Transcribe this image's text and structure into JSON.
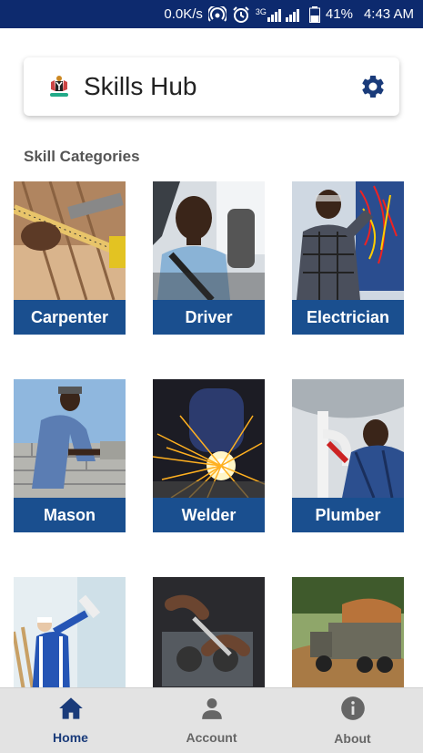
{
  "status_bar": {
    "speed": "0.0K/s",
    "network": "3G",
    "battery": "41%",
    "time": "4:43 AM"
  },
  "header": {
    "title": "Skills Hub",
    "logo_icon": "coat-of-arms-icon",
    "settings_icon": "gear-icon"
  },
  "section_title": "Skill Categories",
  "categories": [
    {
      "label": "Carpenter"
    },
    {
      "label": "Driver"
    },
    {
      "label": "Electrician"
    },
    {
      "label": "Mason"
    },
    {
      "label": "Welder"
    },
    {
      "label": "Plumber"
    },
    {
      "label": ""
    },
    {
      "label": ""
    },
    {
      "label": ""
    }
  ],
  "bottom_nav": {
    "items": [
      {
        "label": "Home",
        "icon": "home-icon",
        "active": true
      },
      {
        "label": "Account",
        "icon": "person-icon",
        "active": false
      },
      {
        "label": "About",
        "icon": "info-icon",
        "active": false
      }
    ]
  },
  "colors": {
    "status_bar": "#0d2a6e",
    "accent": "#1a3b7a",
    "card_label_bg": "#1a4f8f"
  }
}
